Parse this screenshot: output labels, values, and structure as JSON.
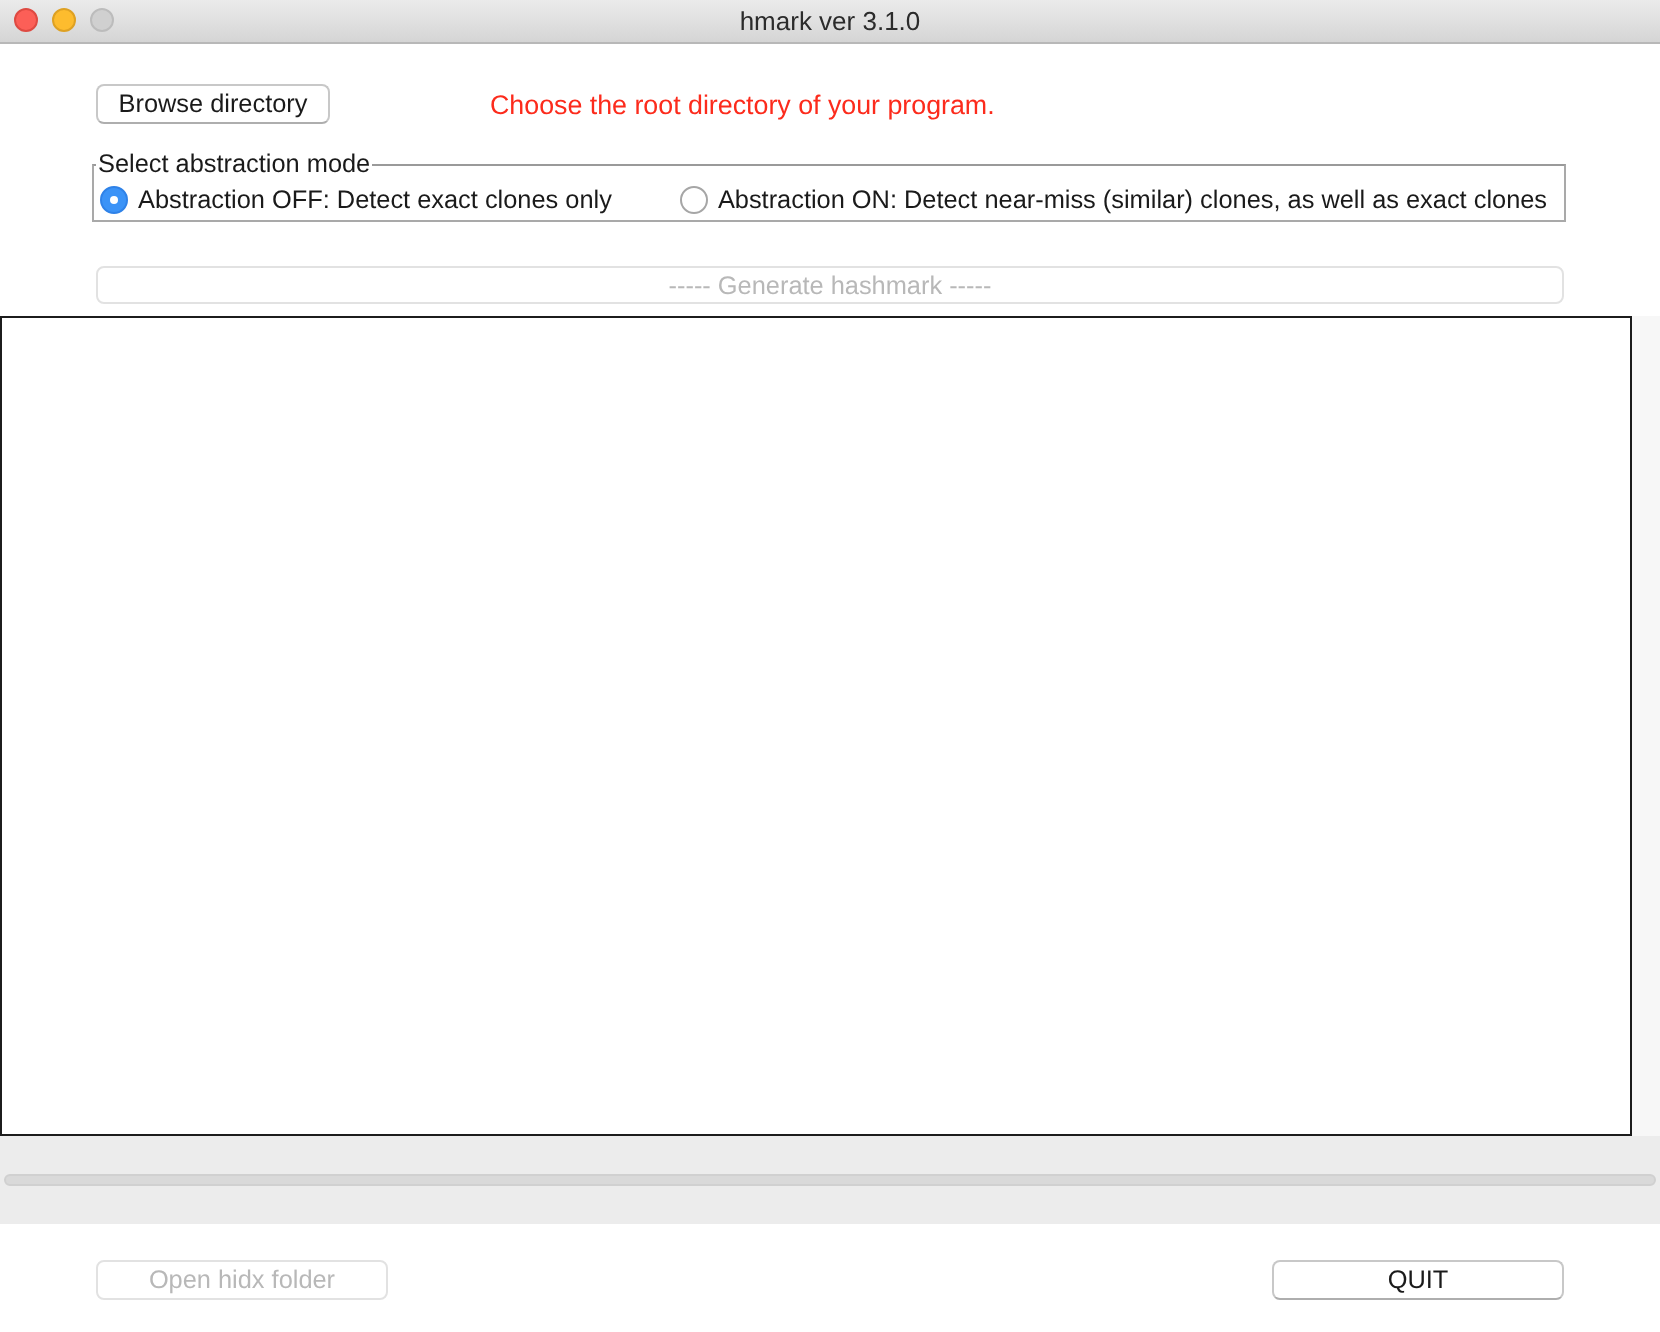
{
  "window": {
    "title": "hmark ver 3.1.0"
  },
  "browse_button": {
    "label": "Browse directory",
    "disabled": false
  },
  "status_message": "Choose the root directory of your program.",
  "abstraction_mode": {
    "legend": "Select abstraction mode",
    "options": [
      {
        "label": "Abstraction OFF: Detect exact clones only",
        "selected": true
      },
      {
        "label": "Abstraction ON: Detect near-miss (similar) clones, as well as exact clones",
        "selected": false
      }
    ]
  },
  "generate_button": {
    "label": "----- Generate hashmark -----",
    "disabled": true
  },
  "progress": {
    "level": 0
  },
  "buttons": [
    {
      "label": "Open hidx folder",
      "disabled": true
    },
    {
      "label": "QUIT",
      "disabled": false
    }
  ]
}
